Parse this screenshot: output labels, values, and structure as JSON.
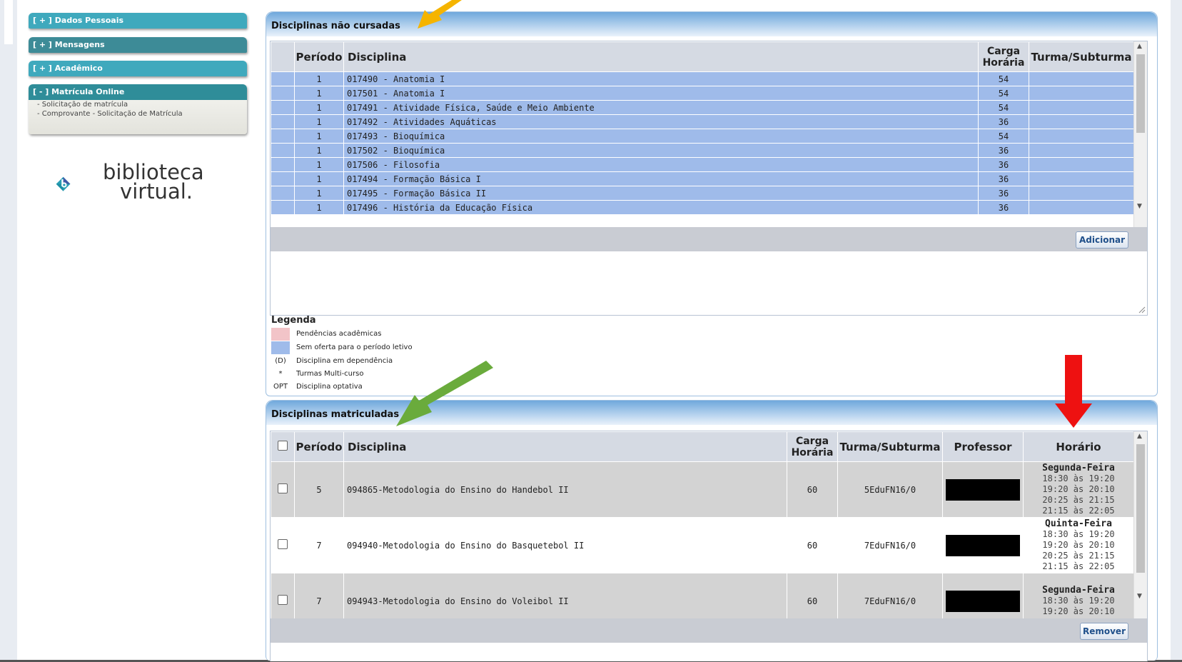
{
  "sidebar": {
    "items": [
      {
        "label": "[ + ] Dados Pessoais"
      },
      {
        "label": "[ + ] Mensagens"
      },
      {
        "label": "[ + ] Acadêmico"
      }
    ],
    "open_menu": {
      "label": "[ - ] Matrícula Online",
      "subitems": [
        "- Solicitação de matrícula",
        "- Comprovante - Solicitação de Matrícula"
      ]
    },
    "logo": {
      "line1": "biblioteca",
      "line2": "virtual."
    }
  },
  "panel_nao_cursadas": {
    "title": "Disciplinas não cursadas",
    "headers": [
      "Período",
      "Disciplina",
      "Carga Horária",
      "Turma/Subturma"
    ],
    "header_carga_1": "Carga",
    "header_carga_2": "Horária",
    "rows": [
      {
        "periodo": "1",
        "disciplina": "017490 - Anatomia I",
        "carga": "54",
        "turma": ""
      },
      {
        "periodo": "1",
        "disciplina": "017501 - Anatomia I",
        "carga": "54",
        "turma": ""
      },
      {
        "periodo": "1",
        "disciplina": "017491 - Atividade Física, Saúde e Meio Ambiente",
        "carga": "54",
        "turma": ""
      },
      {
        "periodo": "1",
        "disciplina": "017492 - Atividades Aquáticas",
        "carga": "36",
        "turma": ""
      },
      {
        "periodo": "1",
        "disciplina": "017493 - Bioquímica",
        "carga": "54",
        "turma": ""
      },
      {
        "periodo": "1",
        "disciplina": "017502 - Bioquímica",
        "carga": "36",
        "turma": ""
      },
      {
        "periodo": "1",
        "disciplina": "017506 - Filosofia",
        "carga": "36",
        "turma": ""
      },
      {
        "periodo": "1",
        "disciplina": "017494 - Formação Básica I",
        "carga": "36",
        "turma": ""
      },
      {
        "periodo": "1",
        "disciplina": "017495 - Formação Básica II",
        "carga": "36",
        "turma": ""
      },
      {
        "periodo": "1",
        "disciplina": "017496 - História da Educação Física",
        "carga": "36",
        "turma": ""
      }
    ],
    "add_button": "Adicionar"
  },
  "legend": {
    "title": "Legenda",
    "items": [
      {
        "symbol": "",
        "text": "Pendências acadêmicas",
        "color": "#f2c4c8"
      },
      {
        "symbol": "",
        "text": "Sem oferta para o período letivo",
        "color": "#9fbbea"
      },
      {
        "symbol": "(D)",
        "text": "Disciplina em dependência"
      },
      {
        "symbol": "*",
        "text": "Turmas Multi-curso"
      },
      {
        "symbol": "OPT",
        "text": "Disciplina optativa"
      }
    ]
  },
  "panel_matriculadas": {
    "title": "Disciplinas matriculadas",
    "headers": [
      "Período",
      "Disciplina",
      "Carga Horária",
      "Turma/Subturma",
      "Professor",
      "Horário"
    ],
    "header_carga_1": "Carga",
    "header_carga_2": "Horária",
    "rows": [
      {
        "periodo": "5",
        "disciplina": "094865-Metodologia do Ensino do Handebol II",
        "carga": "60",
        "turma": "5EduFN16/0",
        "dia": "Segunda-Feira",
        "horarios": [
          "18:30 às 19:20",
          "19:20 às 20:10",
          "20:25 às 21:15",
          "21:15 às 22:05"
        ]
      },
      {
        "periodo": "7",
        "disciplina": "094940-Metodologia do Ensino do Basquetebol II",
        "carga": "60",
        "turma": "7EduFN16/0",
        "dia": "Quinta-Feira",
        "horarios": [
          "18:30 às 19:20",
          "19:20 às 20:10",
          "20:25 às 21:15",
          "21:15 às 22:05"
        ]
      },
      {
        "periodo": "7",
        "disciplina": "094943-Metodologia do Ensino do Voleibol II",
        "carga": "60",
        "turma": "7EduFN16/0",
        "dia": "Segunda-Feira",
        "horarios": [
          "18:30 às 19:20",
          "19:20 às 20:10"
        ]
      }
    ],
    "remove_button": "Remover"
  },
  "colors": {
    "arrow_orange": "#f5b400",
    "arrow_green": "#6aab3c",
    "arrow_red": "#ee1111",
    "unavailable_row": "#9fbbea"
  }
}
